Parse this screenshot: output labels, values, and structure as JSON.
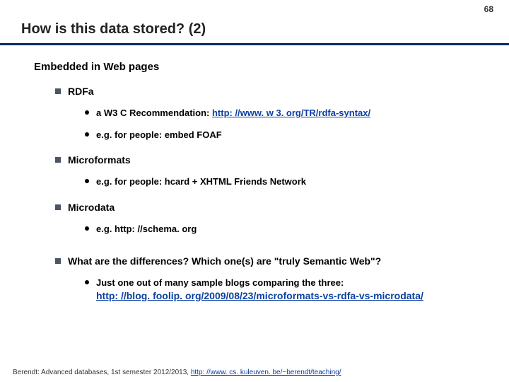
{
  "page_number": "68",
  "title": "How is this data stored? (2)",
  "heading": "Embedded in Web pages",
  "items": [
    {
      "label": "RDFa",
      "sub": [
        {
          "prefix": "a W3 C Recommendation: ",
          "link": "http: //www. w 3. org/TR/rdfa-syntax/"
        },
        {
          "prefix": "e.g. for people: embed FOAF",
          "link": ""
        }
      ]
    },
    {
      "label": "Microformats",
      "sub": [
        {
          "prefix": "e.g. for people: hcard + XHTML Friends Network",
          "link": ""
        }
      ]
    },
    {
      "label": "Microdata",
      "sub": [
        {
          "prefix": "e.g. http: //schema. org",
          "link": ""
        }
      ]
    },
    {
      "label": "What are the differences? Which one(s) are \"truly Semantic Web\"?",
      "sub": [
        {
          "prefix": "Just one out of many sample blogs comparing the three: ",
          "link": "http: //blog. foolip. org/2009/08/23/microformats-vs-rdfa-vs-microdata/"
        }
      ]
    }
  ],
  "footer_prefix": "Berendt: Advanced databases, 1st semester 2012/2013, ",
  "footer_link": "http: //www. cs. kuleuven. be/~berendt/teaching/"
}
